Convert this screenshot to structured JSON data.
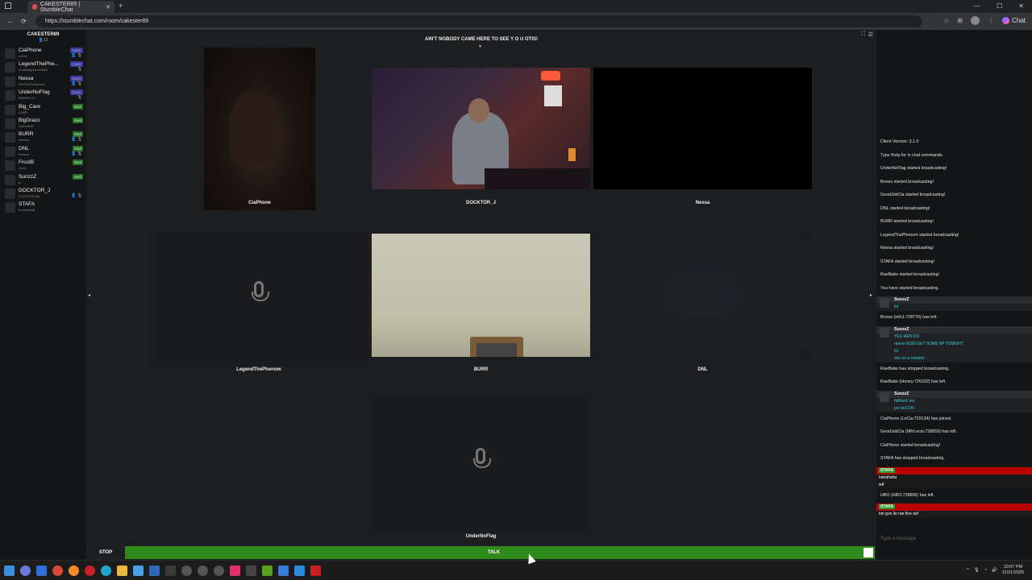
{
  "browser": {
    "tab_title": "CAKESTER89 | StumbleChat",
    "tab_close": "✕",
    "new_tab": "+",
    "url": "https://stumblechat.com/room/cakester89",
    "chat_button": "Chat",
    "window_controls": [
      "—",
      "☐",
      "✕"
    ]
  },
  "room": {
    "name": "CAKESTER89",
    "count": "👤12",
    "topic": "AIN'T NOBODY CAME HERE TO SEE Y O U OTIS!"
  },
  "userlist": [
    {
      "name": "CiaPhone",
      "sub": "LeCia",
      "badge": "Super",
      "badge_type": "super",
      "icons": "👤 🎙"
    },
    {
      "name": "LegendThePhe...",
      "sub": "mobileapphonmdam",
      "badge": "Super",
      "badge_type": "super",
      "icons": "🎙"
    },
    {
      "name": "Nessa",
      "sub": "IntoThePinkNessa",
      "badge": "Super",
      "badge_type": "super",
      "icons": "👤 🎙"
    },
    {
      "name": "UnderNoFlag",
      "sub": "BNARDY17",
      "badge": "Super",
      "badge_type": "super",
      "icons": "🎙"
    },
    {
      "name": "Big_Care",
      "sub": "CARE",
      "badge": "Mod",
      "badge_type": "mod",
      "icons": ""
    },
    {
      "name": "BigDraco",
      "sub": "2wheelsSF",
      "badge": "Mod",
      "badge_type": "mod",
      "icons": ""
    },
    {
      "name": "BURR",
      "sub": "aveburr",
      "badge": "Mod",
      "badge_type": "mod",
      "icons": "👤 🎙"
    },
    {
      "name": "DNL",
      "sub": "Kassan",
      "badge": "Mod",
      "badge_type": "mod",
      "icons": "👤 🎙"
    },
    {
      "name": "FrostB",
      "sub": "Jordi",
      "badge": "Mod",
      "badge_type": "mod",
      "icons": ""
    },
    {
      "name": "SunzzZ",
      "sub": "lu",
      "badge": "Mod",
      "badge_type": "mod",
      "icons": ""
    },
    {
      "name": "DOCKTOR_J",
      "sub": "DOCKTORJay",
      "badge": "",
      "badge_type": "",
      "icons": "👤 🎙"
    },
    {
      "name": "STAFA",
      "sub": "bruhhhstaff",
      "badge": "",
      "badge_type": "",
      "icons": ""
    }
  ],
  "cams": {
    "ciaphone": "CiaPhone",
    "docktor": "DOCKTOR_J",
    "nessa": "Nessa",
    "legend": "LegendThePhenom",
    "burr": "BURR",
    "dnl": "DNL",
    "undernoflag": "UnderNoFlag"
  },
  "chat": {
    "system_top": [
      "Client Version: 3.1.0",
      "Type /help for in chat commands.",
      "UnderNoFlag started broadcasting!",
      "Bones started broadcasting!",
      "GoodJobCia started broadcasting!",
      "DNL started broadcasting!",
      "BURR started broadcasting!",
      "LegendThePhenom started broadcasting!",
      "Nessa started broadcasting!",
      "STAFA started broadcasting!",
      "RaeBabe started broadcasting!",
      "You have started broadcasting."
    ],
    "msg1_user": "SunzzZ",
    "msg1_lines": [
      "lol"
    ],
    "sys_mid1": "Bones (ekh1:728770) has left.",
    "msg2_user": "SunzzZ",
    "msg2_lines": [
      "YES MEN DO",
      "raeee GOIN GET SOME 8P TONIGHT",
      "lol",
      "she on a mission"
    ],
    "sys_mid2": [
      "RaeBabe has stopped broadcasting.",
      "RaeBabe (Honey:726232) has left."
    ],
    "msg3_user": "SunzzZ",
    "msg3_lines": [
      "fallback too",
      "joe beCON"
    ],
    "sys_mid3": [
      "CiaPhone (LeCia:729134) has joined.",
      "GoodJobCia (MlhLecia:728659) has left.",
      "CiaPhone started broadcasting!",
      "STAFA has stopped broadcasting."
    ],
    "msg4_user": "STAFA",
    "msg4_lines": [
      "hahahaha",
      "wtf"
    ],
    "sys_mid4": "HBO (HBO:728865) has left.",
    "msg5_user": "STAFA",
    "msg5_lines": [
      "ion gon lie rae fine asf"
    ],
    "input_placeholder": "Type a message"
  },
  "controls": {
    "stop": "STOP",
    "talk": "TALK"
  },
  "clock": {
    "time": "10:07 PM",
    "date": "11/21/2025"
  },
  "colors": {
    "talk_green": "#2e8a1a",
    "chat_red": "#b80000",
    "chat_cyan": "#3fd0e0"
  }
}
